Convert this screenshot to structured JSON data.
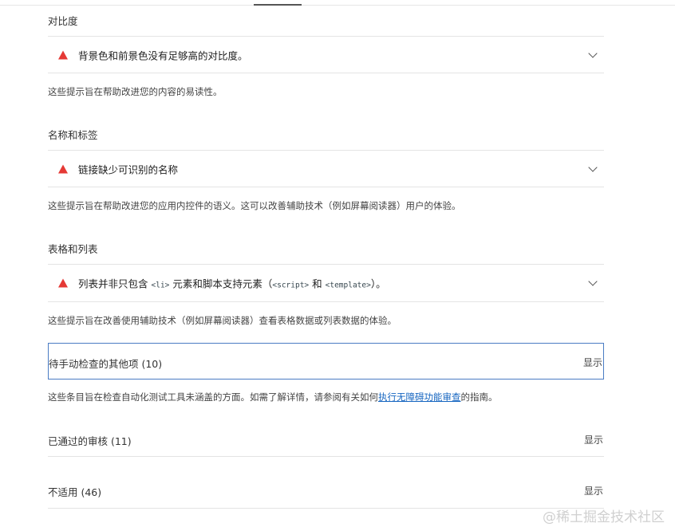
{
  "sections": [
    {
      "title": "对比度",
      "audit": {
        "text": "背景色和前景色没有足够高的对比度。"
      },
      "description": "这些提示旨在帮助改进您的内容的易读性。"
    },
    {
      "title": "名称和标签",
      "audit": {
        "text": "链接缺少可识别的名称"
      },
      "description": "这些提示旨在帮助改进您的应用内控件的语义。这可以改善辅助技术（例如屏幕阅读器）用户的体验。"
    },
    {
      "title": "表格和列表",
      "audit": {
        "part1": "列表并非只包含",
        "code1": "<li>",
        "part2": "元素和脚本支持元素（",
        "code2": "<script>",
        "part3": "和",
        "code3": "<template>",
        "part4": "）。"
      },
      "description": "这些提示旨在改善使用辅助技术（例如屏幕阅读器）查看表格数据或列表数据的体验。"
    }
  ],
  "manual": {
    "label": "待手动检查的其他项 (10)",
    "show": "显示",
    "description_before": "这些条目旨在检查自动化测试工具未涵盖的方面。如需了解详情，请参阅有关如何",
    "link": "执行无障碍功能审查",
    "description_after": "的指南。"
  },
  "passed": {
    "label": "已通过的审核 (11)",
    "show": "显示"
  },
  "not_applicable": {
    "label": "不适用 (46)",
    "show": "显示"
  },
  "watermark": "@稀土掘金技术社区",
  "colors": {
    "warning": "#e53935",
    "link": "#1565c0",
    "focus_border": "#4a7cc4"
  }
}
